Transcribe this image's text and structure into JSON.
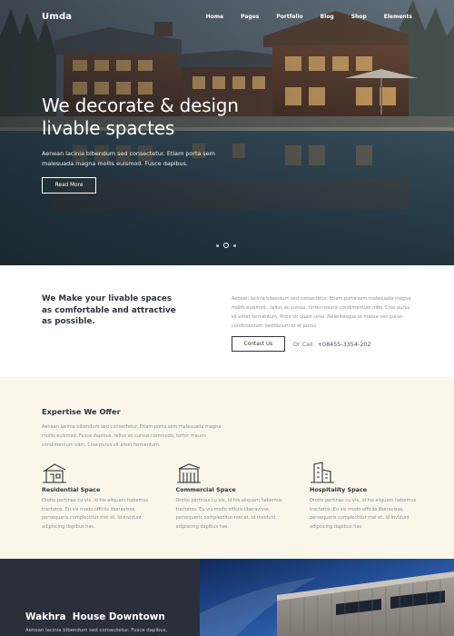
{
  "nav": {
    "logo": "Umda",
    "links": [
      "Home",
      "Pages",
      "Portfolio",
      "Blog",
      "Shop",
      "Elements"
    ]
  },
  "hero": {
    "title_line1": "We decorate & design",
    "title_line2": "livable spactes",
    "subtitle": "Aenean lacinia bibendum sed consectetur. Etiam porta sem malesuada magna mollis euismod. Fusce dapibus.",
    "button": "Read More",
    "slides": 3,
    "active_slide": 2
  },
  "intro": {
    "heading": "We Make your livable spaces as comfortable and attractive as possible.",
    "text": "Aenean lacinia bibendum sed consectetur. Etiam porta sem malesuada magna mollis euismod.. tellus ac cursus, tortor mauris condimentum nibh, Cras purus sit amet fermentum. Proin sit quam urna. Pellentesque et massa nec purus condimentum vestibulum et et purus.",
    "contact_button": "Contact Us",
    "call_label": "Or Call",
    "phone": "+08455-3354-202"
  },
  "expertise": {
    "title": "Expertise We Offer",
    "text": "Aenean lacinia bibendum sed consectetur. Etiam porta sem malesuada magna mollis euismod. Fusce dapibus, tellus ac cursus commodo, tortor mauris condimentum nibh, Cras purus sit amet fermentum.",
    "services": [
      {
        "title": "Residential Space",
        "icon": "residential-building-icon",
        "text": "Orotio pertinax cu vix, id his aliquam habemus tractatos. Eu vis modo officiis liberavisse, persequeris complectitur mei et. Id invidunt adipiscing dapibus has."
      },
      {
        "title": "Commercial Space",
        "icon": "commercial-building-icon",
        "text": "Orotio pertinax cu vix, id his aliquam habemus tractatos. Eu vis modo officiis liberavisse, persequeris complectitur mei et. Id invidunt adipiscing dapibus has."
      },
      {
        "title": "Hospitality Space",
        "icon": "hospitality-building-icon",
        "text": "Orotio pertinax cu vix, id his aliquam habemus tractatos. Eu vis modo officiis liberavisse, persequeris complectitur mei et. Id invidunt adipiscing dapibus has."
      }
    ]
  },
  "featured": {
    "title": "Wakhra  House Downtown",
    "text": "Aenean lacinia bibendum sed consectetur. Fusce dapibus,"
  },
  "colors": {
    "dark": "#2b2f3b",
    "cream": "#faf7ea",
    "text_muted": "#8c8f99"
  }
}
